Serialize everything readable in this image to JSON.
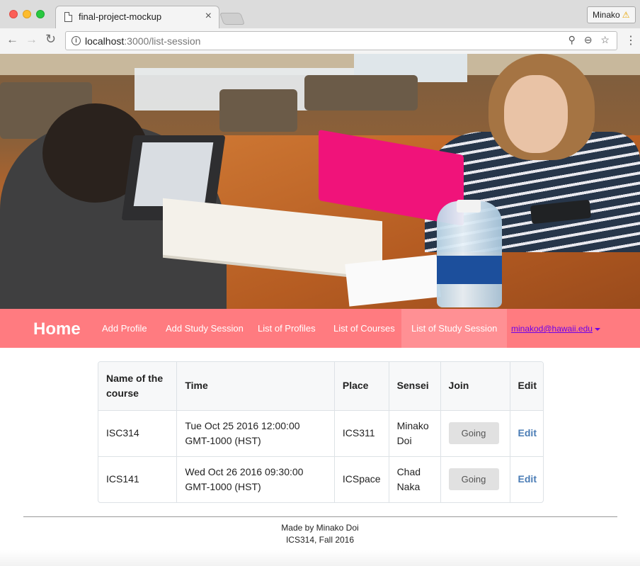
{
  "browser": {
    "tab_title": "final-project-mockup",
    "tab_close": "×",
    "profile_name": "Minako",
    "profile_warning": "⚠",
    "url_host": "localhost",
    "url_rest": ":3000/list-session",
    "back_icon": "←",
    "forward_icon": "→",
    "reload_icon": "↻",
    "info_icon": "i",
    "omnibox_icons": "⚲ ⊖ ☆",
    "menu_icon": "⋮"
  },
  "navbar": {
    "brand": "Home",
    "items": [
      {
        "label": "Add Profile"
      },
      {
        "label": "Add Study Session"
      },
      {
        "label": "List of Profiles"
      },
      {
        "label": "List of Courses"
      },
      {
        "label": "List of Study Session",
        "active": true
      }
    ],
    "user_email": "minakod@hawaii.edu",
    "accent_color": "#ff7b80"
  },
  "table": {
    "headers": {
      "course_line1": "Name of the",
      "course_line2": "course",
      "time": "Time",
      "place": "Place",
      "sensei": "Sensei",
      "join": "Join",
      "edit": "Edit"
    },
    "rows": [
      {
        "course": "ISC314",
        "time_line1": "Tue Oct 25 2016 12:00:00",
        "time_line2": "GMT-1000 (HST)",
        "place": "ICS311",
        "sensei_line1": "Minako",
        "sensei_line2": "Doi",
        "join_label": "Going",
        "edit_label": "Edit"
      },
      {
        "course": "ICS141",
        "time_line1": "Wed Oct 26 2016 09:30:00",
        "time_line2": "GMT-1000 (HST)",
        "place": "ICSpace",
        "sensei_line1": "Chad",
        "sensei_line2": "Naka",
        "join_label": "Going",
        "edit_label": "Edit"
      }
    ]
  },
  "footer": {
    "line1": "Made by Minako Doi",
    "line2": "ICS314, Fall 2016"
  }
}
